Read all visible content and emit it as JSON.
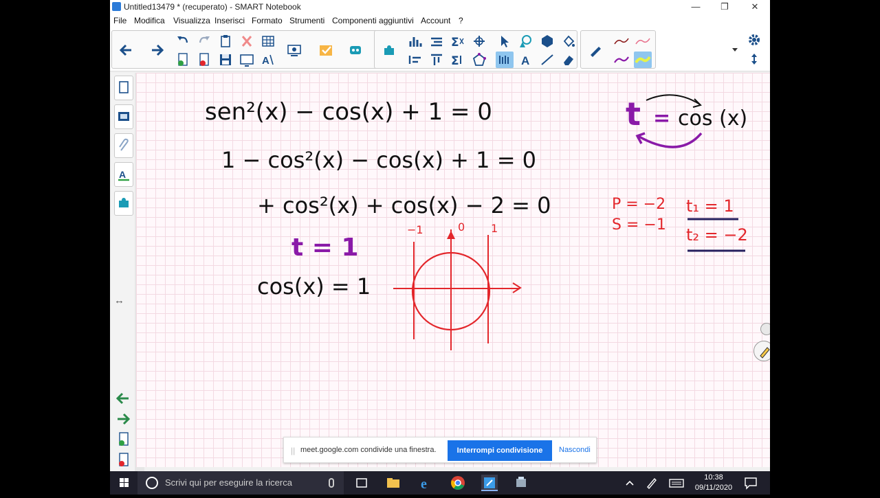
{
  "window": {
    "title": "Untitled13479 * (recuperato) - SMART Notebook",
    "minimize_glyph": "—",
    "maximize_glyph": "❐",
    "close_glyph": "✕"
  },
  "menu": [
    "File",
    "Modifica",
    "Visualizza",
    "Inserisci",
    "Formato",
    "Strumenti",
    "Componenti aggiuntivi",
    "Account",
    "?"
  ],
  "sidebar": {
    "items": [
      "page-sorter-icon",
      "gallery-icon",
      "attachments-icon",
      "properties-icon",
      "addons-icon"
    ],
    "resize_glyph": "↔"
  },
  "canvas": {
    "ink_colors": {
      "black": "#111111",
      "purple": "#8a1aa8",
      "red": "#e3262b",
      "navy": "#26205e"
    },
    "equations": {
      "eq1": "sen²(x) − cos(x) + 1 = 0",
      "eq2": "1 − cos²(x) − cos(x) + 1 = 0",
      "eq3": "+ cos²(x) + cos(x) − 2 = 0",
      "sub": "t = 1",
      "result": "cos(x) = 1"
    },
    "substitution": {
      "t": "t",
      "eq": "=",
      "cos": "cos (x)"
    },
    "pq": {
      "p": "P = −2",
      "s": "S = −1"
    },
    "roots": {
      "t1": "t₁ = 1",
      "t2": "t₂ = −2"
    },
    "circle_labels": {
      "left": "−1",
      "top": "0",
      "right": "1"
    }
  },
  "notice": {
    "message": "meet.google.com condivide una finestra.",
    "stop_label": "Interrompi condivisione",
    "hide_label": "Nascondi",
    "grip": "||"
  },
  "taskbar": {
    "search_placeholder": "Scrivi qui per eseguire la ricerca",
    "time": "10:38",
    "date": "09/11/2020"
  }
}
